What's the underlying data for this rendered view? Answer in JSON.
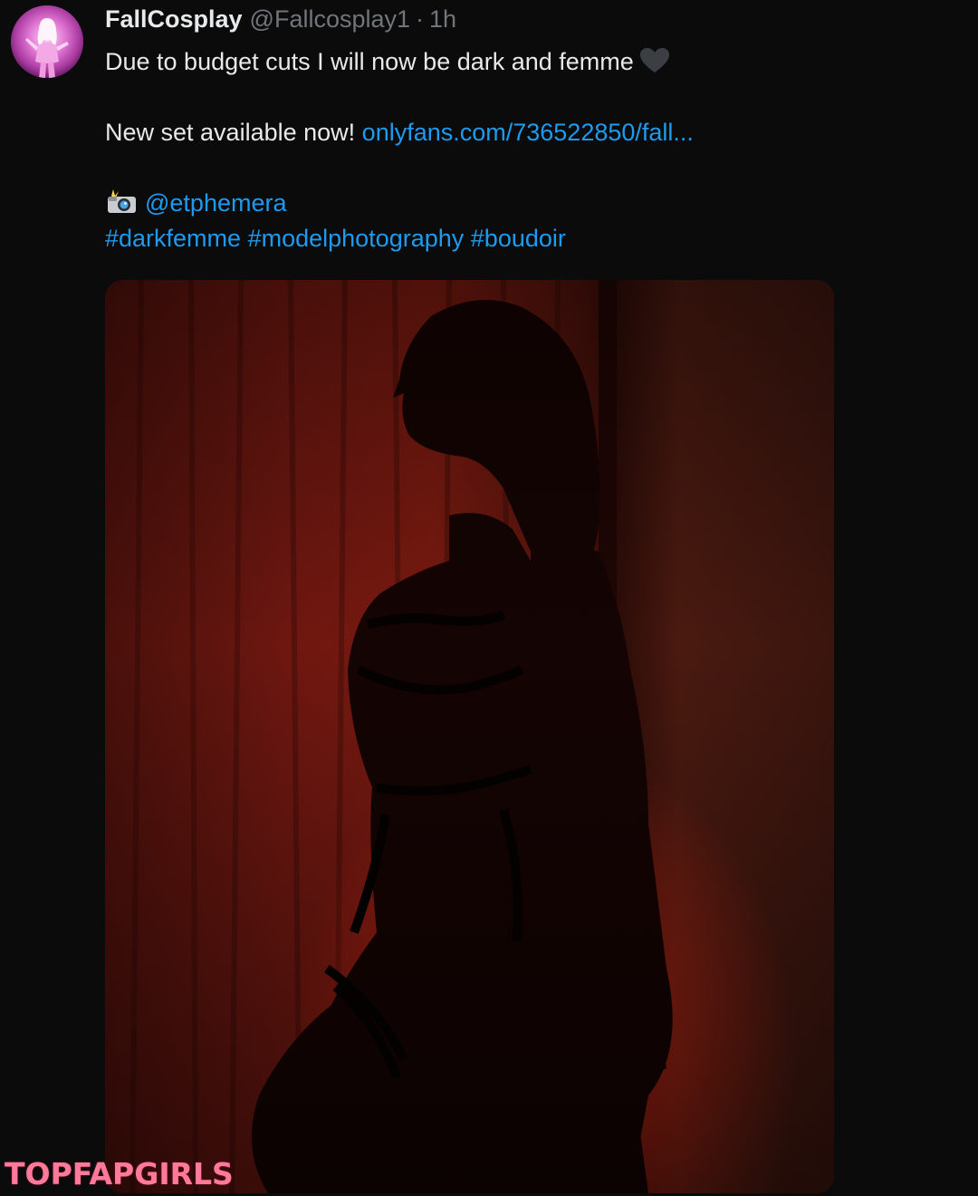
{
  "tweet": {
    "display_name": "FallCosplay",
    "handle": "@Fallcosplay1",
    "separator": "·",
    "timestamp": "1h",
    "line1_text": "Due to budget cuts I will now be dark and femme",
    "line1_emoji_icon": "black-heart-icon",
    "line2_text": "New set available now!",
    "line2_link": "onlyfans.com/736522850/fall...",
    "credit_emoji_icon": "camera-with-flash-icon",
    "credit_mention": "@etphemera",
    "hashtags": [
      "#darkfemme",
      "#modelphotography",
      "#boudoir"
    ]
  },
  "colors": {
    "background": "#0b0b0b",
    "text": "#e7e9ea",
    "secondary_text": "#71767b",
    "link": "#1d9bf0",
    "watermark": "#ff7a9a"
  },
  "watermark": {
    "text": "TOPFAPGIRLS"
  }
}
